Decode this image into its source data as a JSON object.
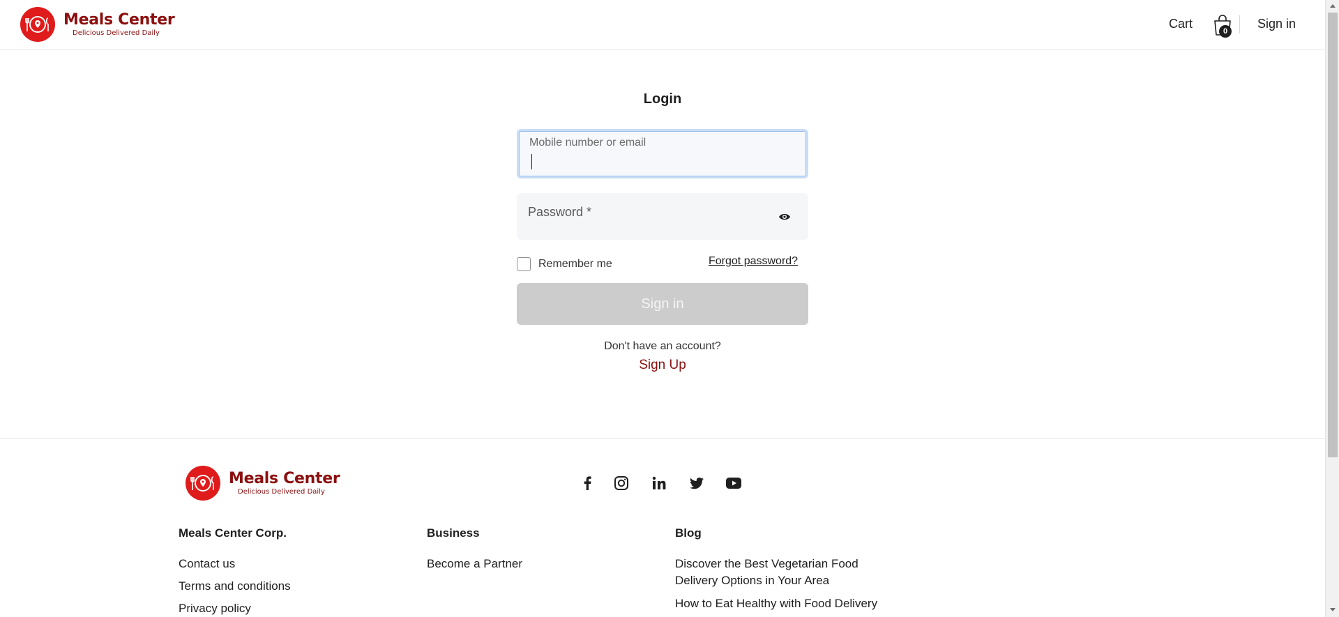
{
  "header": {
    "brand_name": "Meals Center",
    "brand_tagline": "Delicious Delivered Daily",
    "cart_label": "Cart",
    "cart_count": "0",
    "signin_label": "Sign in"
  },
  "login": {
    "title": "Login",
    "email_placeholder": "Mobile number or email",
    "password_placeholder": "Password *",
    "remember_label": "Remember me",
    "forgot_label": "Forgot password?",
    "submit_label": "Sign in",
    "no_account_text": "Don't have an account?",
    "signup_label": "Sign Up"
  },
  "footer": {
    "brand_name": "Meals Center",
    "brand_tagline": "Delicious Delivered Daily",
    "social": [
      "facebook-icon",
      "instagram-icon",
      "linkedin-icon",
      "twitter-icon",
      "youtube-icon"
    ],
    "columns": [
      {
        "title": "Meals Center Corp.",
        "links": [
          "Contact us",
          "Terms and conditions",
          "Privacy policy"
        ]
      },
      {
        "title": "Business",
        "links": [
          "Become a Partner"
        ]
      },
      {
        "title": "Blog",
        "links": [
          "Discover the Best Vegetarian Food Delivery Options in Your Area",
          "How to Eat Healthy with Food Delivery"
        ]
      }
    ]
  },
  "colors": {
    "brand_red": "#e01b1b",
    "brand_dark_red": "#8c0f0f",
    "disabled_button": "#cccccc",
    "focus_border": "#c9ddf5"
  }
}
